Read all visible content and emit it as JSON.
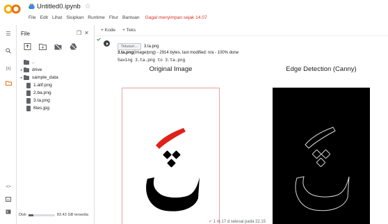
{
  "header": {
    "notebook_title": "Untitled0.ipynb",
    "star_icon": "star-outline-icon",
    "menu": [
      "File",
      "Edit",
      "Lihat",
      "Sisipkan",
      "Runtime",
      "Fitur",
      "Bantuan"
    ],
    "save_warning": "Gagal menyimpan sejak 14.07",
    "warning_color": "#d93025"
  },
  "rail": {
    "icons": [
      "toc-icon",
      "search-icon",
      "variables-icon",
      "folder-icon",
      "code-icon",
      "terminal-icon",
      "console-icon"
    ],
    "variables_label": "{x}",
    "code_label": "<>"
  },
  "files_panel": {
    "title": "File",
    "tools": [
      "upload-icon",
      "new-folder-icon",
      "hide-drive-icon",
      "mount-drive-icon"
    ],
    "tree": [
      {
        "type": "folder",
        "label": "..",
        "caret": ""
      },
      {
        "type": "folder",
        "label": "drive",
        "caret": "▸"
      },
      {
        "type": "folder",
        "label": "sample_data",
        "caret": "▸"
      },
      {
        "type": "file",
        "label": "1.alif.png"
      },
      {
        "type": "file",
        "label": "2.ba.png"
      },
      {
        "type": "file",
        "label": "3.ta.png"
      },
      {
        "type": "file",
        "label": "6tes.jpg"
      }
    ],
    "disk_label": "Disk",
    "disk_free": "83.42 GB tersedia",
    "disk_used_fraction": 0.2
  },
  "toolbar": {
    "add_code": "+ Kode",
    "add_text": "+ Teks"
  },
  "cell": {
    "gutter_text": "✓\n1m",
    "browse_label": "Telusuri...",
    "chosen_file": "3.ta.png",
    "upload_name": "3.ta.png",
    "upload_info": "(image/png) - 2914 bytes, last modified: n/a - 100% done",
    "saving_line": "Saving 3.ta.png to 3.ta.png",
    "left_title": "Original Image",
    "right_title": "Edge Detection (Canny)",
    "accent_red": "#e0211b"
  },
  "status": {
    "text": "✓ 1 m 17 d    selesai pada 22.15"
  }
}
